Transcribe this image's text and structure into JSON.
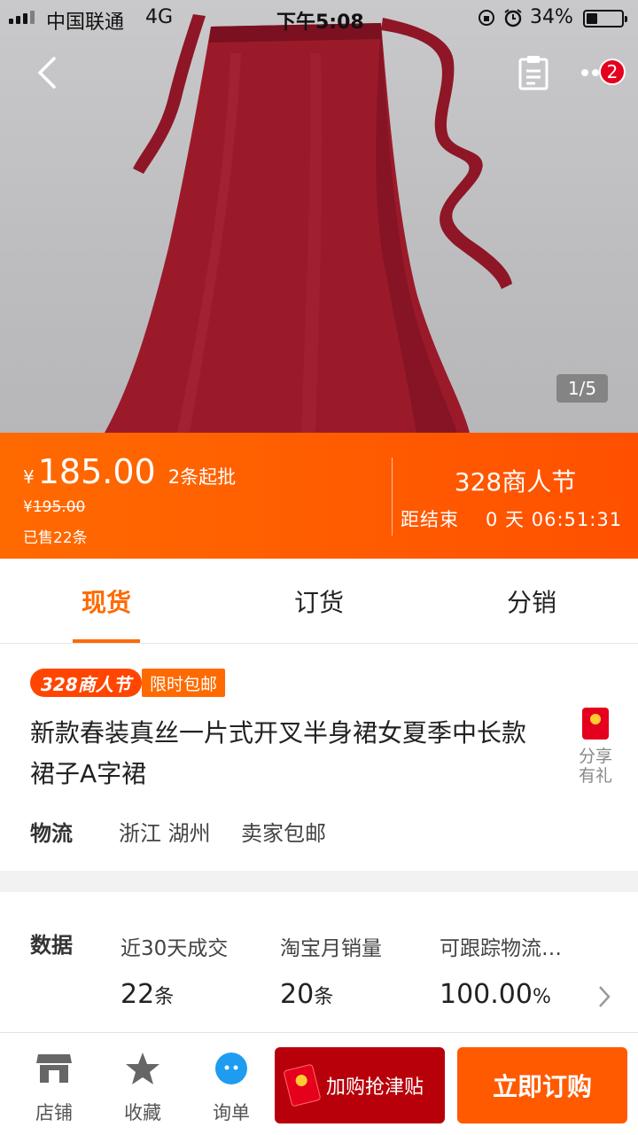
{
  "status_bar": {
    "carrier": "中国联通",
    "network": "4G",
    "time": "下午5:08",
    "battery": "34%"
  },
  "gallery": {
    "page_indicator": "1/5",
    "notification_badge": "2"
  },
  "price": {
    "currency": "¥",
    "current": "185.00",
    "min_order": "2条起批",
    "original": "195.00",
    "sold": "已售22条"
  },
  "promo": {
    "title": "328商人节",
    "ends_label": "距结束",
    "days": "0 天",
    "time_left": "06:51:31"
  },
  "tabs": [
    {
      "label": "现货",
      "active": true
    },
    {
      "label": "订货",
      "active": false
    },
    {
      "label": "分销",
      "active": false
    }
  ],
  "product": {
    "tag_festival": "328商人节",
    "tag_shipping": "限时包邮",
    "title": "新款春装真丝一片式开叉半身裙女夏季中长款裙子A字裙",
    "share_label": "分享有礼"
  },
  "logistics": {
    "label": "物流",
    "origin": "浙江 湖州",
    "shipping": "卖家包邮"
  },
  "stats": {
    "label": "数据",
    "items": [
      {
        "label": "近30天成交",
        "value": "22",
        "unit": "条"
      },
      {
        "label": "淘宝月销量",
        "value": "20",
        "unit": "条"
      },
      {
        "label": "可跟踪物流…",
        "value": "100.00",
        "unit": "%"
      }
    ]
  },
  "bottom_bar": {
    "store": "店铺",
    "favorite": "收藏",
    "inquiry": "询单",
    "promo_button": "加购抢津贴",
    "buy_button": "立即订购"
  },
  "colors": {
    "accent": "#ff6a00",
    "price_band": "#ff5000",
    "promo_button": "#b8000b",
    "product": "#9b1a2a"
  },
  "icons": [
    "back-arrow-icon",
    "clipboard-icon",
    "more-dots-icon",
    "red-envelope-icon",
    "store-icon",
    "star-icon",
    "chat-icon",
    "chevron-right-icon"
  ]
}
